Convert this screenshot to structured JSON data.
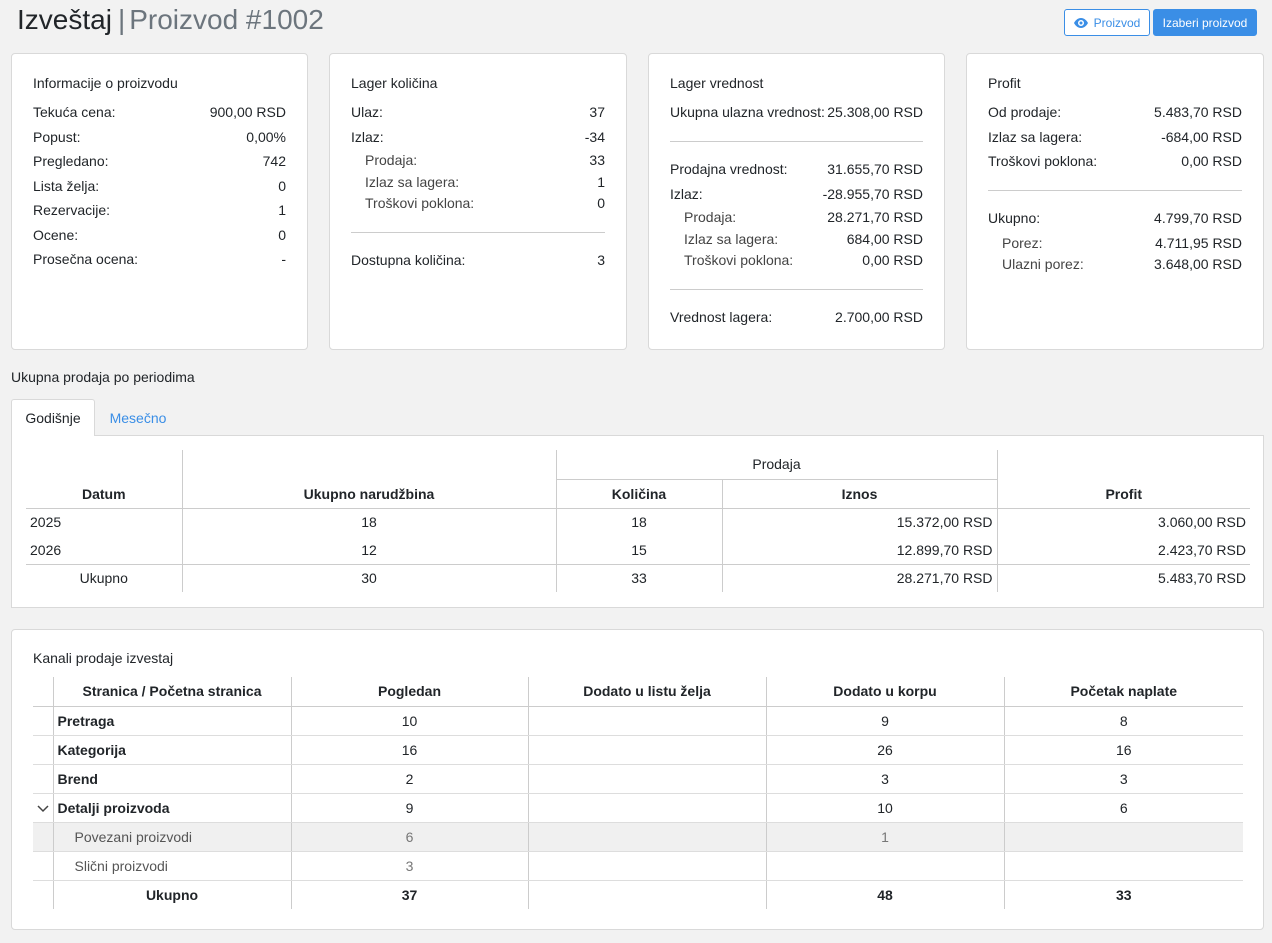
{
  "header": {
    "title": "Izveštaj",
    "separator": "|",
    "subtitle": "Proizvod #1002",
    "btn_product": "Proizvod",
    "btn_choose": "Izaberi proizvod"
  },
  "info_card": {
    "title": "Informacije o proizvodu",
    "rows": [
      {
        "label": "Tekuća cena:",
        "value": "900,00 RSD"
      },
      {
        "label": "Popust:",
        "value": "0,00%"
      },
      {
        "label": "Pregledano:",
        "value": "742"
      },
      {
        "label": "Lista želja:",
        "value": "0"
      },
      {
        "label": "Rezervacije:",
        "value": "1"
      },
      {
        "label": "Ocene:",
        "value": "0"
      },
      {
        "label": "Prosečna ocena:",
        "value": "-"
      }
    ]
  },
  "stock_qty": {
    "title": "Lager količina",
    "in_label": "Ulaz:",
    "in_value": "37",
    "out_label": "Izlaz:",
    "out_value": "-34",
    "sub": [
      {
        "label": "Prodaja:",
        "value": "33"
      },
      {
        "label": "Izlaz sa lagera:",
        "value": "1"
      },
      {
        "label": "Troškovi poklona:",
        "value": "0"
      }
    ],
    "available_label": "Dostupna količina:",
    "available_value": "3"
  },
  "stock_value": {
    "title": "Lager vrednost",
    "total_in_label": "Ukupna ulazna vrednost:",
    "total_in_value": "25.308,00 RSD",
    "sales_label": "Prodajna vrednost:",
    "sales_value": "31.655,70 RSD",
    "out_label": "Izlaz:",
    "out_value": "-28.955,70 RSD",
    "sub": [
      {
        "label": "Prodaja:",
        "value": "28.271,70 RSD"
      },
      {
        "label": "Izlaz sa lagera:",
        "value": "684,00 RSD"
      },
      {
        "label": "Troškovi poklona:",
        "value": "0,00 RSD"
      }
    ],
    "stock_label": "Vrednost lagera:",
    "stock_value": "2.700,00 RSD"
  },
  "profit": {
    "title": "Profit",
    "rows": [
      {
        "label": "Od prodaje:",
        "value": "5.483,70 RSD"
      },
      {
        "label": "Izlaz sa lagera:",
        "value": "-684,00 RSD"
      },
      {
        "label": "Troškovi poklona:",
        "value": "0,00 RSD"
      }
    ],
    "total_label": "Ukupno:",
    "total_value": "4.799,70 RSD",
    "sub": [
      {
        "label": "Porez:",
        "value": "4.711,95 RSD"
      },
      {
        "label": "Ulazni porez:",
        "value": "3.648,00 RSD"
      }
    ]
  },
  "sales_section": {
    "title": "Ukupna prodaja po periodima",
    "tabs": [
      "Godišnje",
      "Mesečno"
    ],
    "headers": {
      "date": "Datum",
      "orders": "Ukupno narudžbina",
      "group": "Prodaja",
      "qty": "Količina",
      "amount": "Iznos",
      "profit": "Profit"
    },
    "rows": [
      {
        "date": "2025",
        "orders": "18",
        "qty": "18",
        "amount": "15.372,00 RSD",
        "profit": "3.060,00 RSD"
      },
      {
        "date": "2026",
        "orders": "12",
        "qty": "15",
        "amount": "12.899,70 RSD",
        "profit": "2.423,70 RSD"
      }
    ],
    "total": {
      "date": "Ukupno",
      "orders": "30",
      "qty": "33",
      "amount": "28.271,70 RSD",
      "profit": "5.483,70 RSD"
    }
  },
  "channels": {
    "title": "Kanali prodaje izvestaj",
    "headers": [
      "Stranica / Početna stranica",
      "Pogledan",
      "Dodato u listu želja",
      "Dodato u korpu",
      "Početak naplate"
    ],
    "rows": [
      {
        "name": "Pretraga",
        "viewed": "10",
        "wishlist": "",
        "cart": "9",
        "checkout": "8"
      },
      {
        "name": "Kategorija",
        "viewed": "16",
        "wishlist": "",
        "cart": "26",
        "checkout": "16"
      },
      {
        "name": "Brend",
        "viewed": "2",
        "wishlist": "",
        "cart": "3",
        "checkout": "3"
      },
      {
        "name": "Detalji proizvoda",
        "viewed": "9",
        "wishlist": "",
        "cart": "10",
        "checkout": "6"
      },
      {
        "name": "Povezani proizvodi",
        "viewed": "6",
        "wishlist": "",
        "cart": "1",
        "checkout": ""
      },
      {
        "name": "Slični proizvodi",
        "viewed": "3",
        "wishlist": "",
        "cart": "",
        "checkout": ""
      }
    ],
    "total": {
      "name": "Ukupno",
      "viewed": "37",
      "wishlist": "",
      "cart": "48",
      "checkout": "33"
    }
  }
}
